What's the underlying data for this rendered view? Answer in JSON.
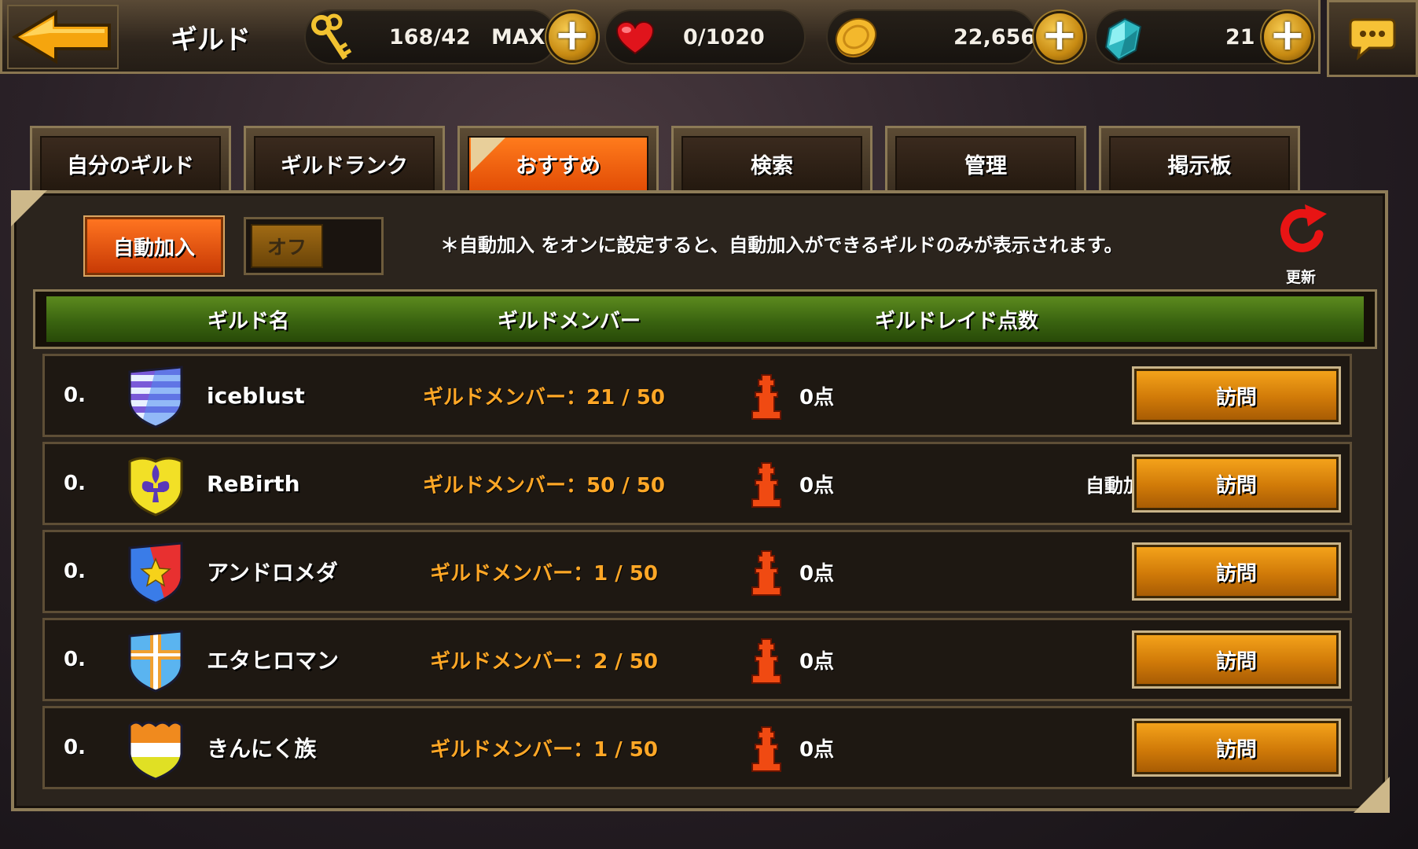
{
  "header": {
    "title": "ギルド",
    "keys": "168/42",
    "keys_max_label": "MAX",
    "hearts": "0/1020",
    "gold": "22,656",
    "gems": "21"
  },
  "tabs": [
    {
      "label": "自分のギルド",
      "active": false
    },
    {
      "label": "ギルドランク",
      "active": false
    },
    {
      "label": "おすすめ",
      "active": true
    },
    {
      "label": "検索",
      "active": false
    },
    {
      "label": "管理",
      "active": false
    },
    {
      "label": "掲示板",
      "active": false
    }
  ],
  "filter": {
    "auto_join_label": "自動加入",
    "toggle_label": "オフ",
    "notice": "＊自動加入 をオンに設定すると、自動加入ができるギルドのみが表示されます。",
    "refresh_label": "更新"
  },
  "columns": {
    "name": "ギルド名",
    "members": "ギルドメンバー",
    "raid_score": "ギルドレイド点数"
  },
  "guilds": [
    {
      "rank": "0.",
      "name": "iceblust",
      "members": "ギルドメンバー：21 / 50",
      "score": "0点",
      "tag": "",
      "visit_label": "訪問",
      "emblem": "striped-shield"
    },
    {
      "rank": "0.",
      "name": "ReBirth",
      "members": "ギルドメンバー：50 / 50",
      "score": "0点",
      "tag": "自動加入",
      "visit_label": "訪問",
      "emblem": "fleur-de-lis-shield"
    },
    {
      "rank": "0.",
      "name": "アンドロメダ",
      "members": "ギルドメンバー：1 / 50",
      "score": "0点",
      "tag": "",
      "visit_label": "訪問",
      "emblem": "star-shield"
    },
    {
      "rank": "0.",
      "name": "エタヒロマン",
      "members": "ギルドメンバー：2 / 50",
      "score": "0点",
      "tag": "",
      "visit_label": "訪問",
      "emblem": "cross-shield"
    },
    {
      "rank": "0.",
      "name": "きんにく族",
      "members": "ギルドメンバー：1 / 50",
      "score": "0点",
      "tag": "",
      "visit_label": "訪問",
      "emblem": "tricolor-shield"
    }
  ],
  "colors": {
    "accent_orange": "#e8560a",
    "member_text": "#ffa726",
    "header_green": "#4a7a16",
    "visit_button": "#e08c10"
  }
}
